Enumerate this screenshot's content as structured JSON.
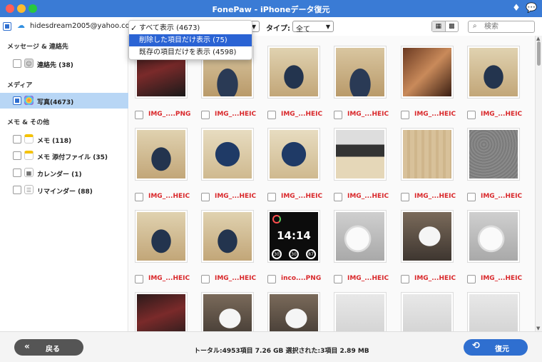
{
  "window": {
    "title": "FonePaw - iPhoneデータ復元"
  },
  "toolbar": {
    "account": "hidesdream2005@yahoo.co.jp",
    "type_label": "タイプ:",
    "type_value": "全て",
    "search_placeholder": "検索"
  },
  "filter_dropdown": {
    "items": [
      {
        "label": "すべて表示 (4673)",
        "checked": true
      },
      {
        "label": "削除した項目だけ表示 (75)",
        "highlighted": true
      },
      {
        "label": "既存の項目だけを表示 (4598)"
      }
    ]
  },
  "sidebar": {
    "sections": [
      {
        "title": "メッセージ & 連絡先",
        "items": [
          {
            "label": "連絡先 (38)",
            "icon": "contacts-icon"
          }
        ]
      },
      {
        "title": "メディア",
        "items": [
          {
            "label": "写真(4673)",
            "icon": "photos-icon",
            "active": true
          }
        ]
      },
      {
        "title": "メモ & その他",
        "items": [
          {
            "label": "メモ (118)",
            "icon": "note-icon"
          },
          {
            "label": "メモ 添付ファイル (35)",
            "icon": "note-icon"
          },
          {
            "label": "カレンダー (1)",
            "icon": "calendar-icon"
          },
          {
            "label": "リマインダー (88)",
            "icon": "reminder-icon"
          }
        ]
      }
    ]
  },
  "grid": {
    "rows": [
      [
        {
          "name": "IMG_....PNG",
          "fill": "f-dark"
        },
        {
          "name": "IMG_...HEIC",
          "fill": "f-stand1"
        },
        {
          "name": "IMG_...HEIC",
          "fill": "f-stand2"
        },
        {
          "name": "IMG_...HEIC",
          "fill": "f-stand1"
        },
        {
          "name": "IMG_...HEIC",
          "fill": "f-hand"
        },
        {
          "name": "IMG_...HEIC",
          "fill": "f-stand2"
        }
      ],
      [
        {
          "name": "IMG_...HEIC",
          "fill": "f-stand2"
        },
        {
          "name": "IMG_...HEIC",
          "fill": "f-band"
        },
        {
          "name": "IMG_...HEIC",
          "fill": "f-band"
        },
        {
          "name": "IMG_...HEIC",
          "fill": "f-keyboard"
        },
        {
          "name": "IMG_...HEIC",
          "fill": "f-wood"
        },
        {
          "name": "IMG_...HEIC",
          "fill": "f-gray"
        }
      ],
      [
        {
          "name": "IMG_...HEIC",
          "fill": "f-stand2"
        },
        {
          "name": "IMG_...HEIC",
          "fill": "f-stand2"
        },
        {
          "name": "inco....PNG",
          "fill": "f-watch",
          "watch": {
            "time": "14:14",
            "rings": [
              "30",
              "30",
              "87"
            ]
          }
        },
        {
          "name": "IMG_...HEIC",
          "fill": "f-charger"
        },
        {
          "name": "IMG_...HEIC",
          "fill": "f-charger2"
        },
        {
          "name": "IMG_...HEIC",
          "fill": "f-charger"
        }
      ],
      [
        {
          "name": "",
          "fill": "f-dark"
        },
        {
          "name": "",
          "fill": "f-charger2"
        },
        {
          "name": "",
          "fill": "f-charger2"
        },
        {
          "name": "",
          "fill": "f-meter"
        },
        {
          "name": "",
          "fill": "f-meter"
        },
        {
          "name": "",
          "fill": "f-meter"
        }
      ]
    ]
  },
  "footer": {
    "back_label": "戻る",
    "status": "トータル:4953項目 7.26 GB   選択された:3項目 2.89 MB",
    "recover_label": "復元"
  },
  "colors": {
    "titlebar": "#3a7bd5",
    "accent": "#2f6fd0",
    "filename_red": "#d9282b",
    "sidebar_active": "#b8d6f5"
  }
}
